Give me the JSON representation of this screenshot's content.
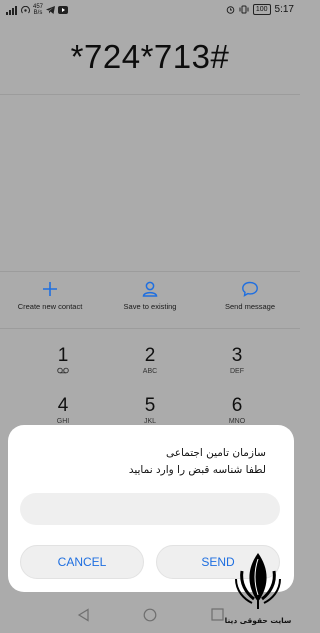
{
  "status_bar": {
    "network_speed_value": "457",
    "network_speed_unit": "B/s",
    "battery": "100",
    "time": "5:17"
  },
  "dialer": {
    "number": "*724*713#"
  },
  "actions": [
    {
      "label": "Create new contact",
      "icon": "plus-icon"
    },
    {
      "label": "Save to existing",
      "icon": "person-icon"
    },
    {
      "label": "Send message",
      "icon": "message-icon"
    }
  ],
  "keypad": [
    {
      "digit": "1",
      "letters": "voicemail-icon"
    },
    {
      "digit": "2",
      "letters": "ABC"
    },
    {
      "digit": "3",
      "letters": "DEF"
    },
    {
      "digit": "4",
      "letters": "GHI"
    },
    {
      "digit": "5",
      "letters": "JKL"
    },
    {
      "digit": "6",
      "letters": "MNO"
    }
  ],
  "dialog": {
    "line1": "سازمان تامین اجتماعی",
    "line2": "لطفا شناسه قبض را وارد نمایید",
    "input_value": "",
    "cancel_label": "CANCEL",
    "send_label": "SEND"
  },
  "navigation": {
    "icons": [
      "back-icon",
      "home-icon",
      "recents-icon"
    ]
  },
  "watermark": {
    "text": "سایت حقوقی دینا"
  },
  "colors": {
    "accent": "#1f6fe0",
    "background": "#ababab",
    "dialog": "#ffffff"
  }
}
